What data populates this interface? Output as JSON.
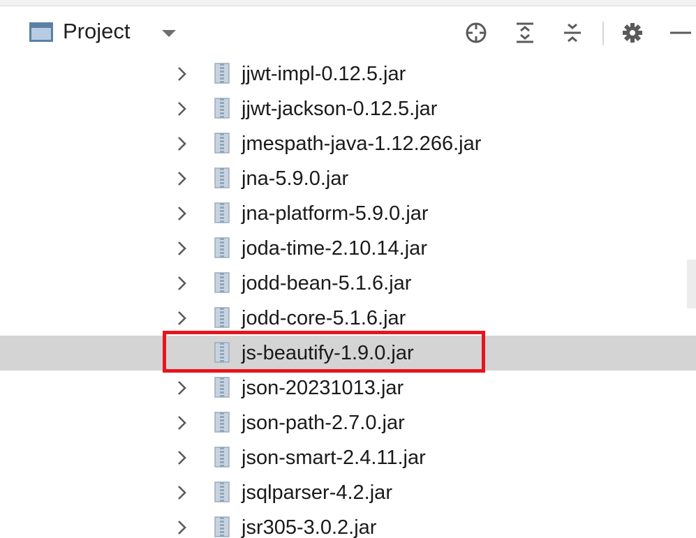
{
  "panel": {
    "title": "Project",
    "view_icon": "project-view-icon",
    "dropdown_icon": "caret-down-icon"
  },
  "toolbar": {
    "tools": [
      {
        "name": "locate-icon"
      },
      {
        "name": "expand-all-icon"
      },
      {
        "name": "collapse-all-icon"
      },
      {
        "name": "gear-icon"
      },
      {
        "name": "hide-icon"
      }
    ]
  },
  "tree": {
    "items": [
      {
        "label": "jjwt-impl-0.12.5.jar",
        "expandable": true,
        "selected": false
      },
      {
        "label": "jjwt-jackson-0.12.5.jar",
        "expandable": true,
        "selected": false
      },
      {
        "label": "jmespath-java-1.12.266.jar",
        "expandable": true,
        "selected": false
      },
      {
        "label": "jna-5.9.0.jar",
        "expandable": true,
        "selected": false
      },
      {
        "label": "jna-platform-5.9.0.jar",
        "expandable": true,
        "selected": false
      },
      {
        "label": "joda-time-2.10.14.jar",
        "expandable": true,
        "selected": false
      },
      {
        "label": "jodd-bean-5.1.6.jar",
        "expandable": true,
        "selected": false
      },
      {
        "label": "jodd-core-5.1.6.jar",
        "expandable": true,
        "selected": false
      },
      {
        "label": "js-beautify-1.9.0.jar",
        "expandable": false,
        "selected": true
      },
      {
        "label": "json-20231013.jar",
        "expandable": true,
        "selected": false
      },
      {
        "label": "json-path-2.7.0.jar",
        "expandable": true,
        "selected": false
      },
      {
        "label": "json-smart-2.4.11.jar",
        "expandable": true,
        "selected": false
      },
      {
        "label": "jsqlparser-4.2.jar",
        "expandable": true,
        "selected": false
      },
      {
        "label": "jsr305-3.0.2.jar",
        "expandable": true,
        "selected": false
      }
    ]
  },
  "colors": {
    "selection": "#d4d4d4",
    "highlight_border": "#e8141c",
    "jar_icon": "#a8bccf"
  }
}
